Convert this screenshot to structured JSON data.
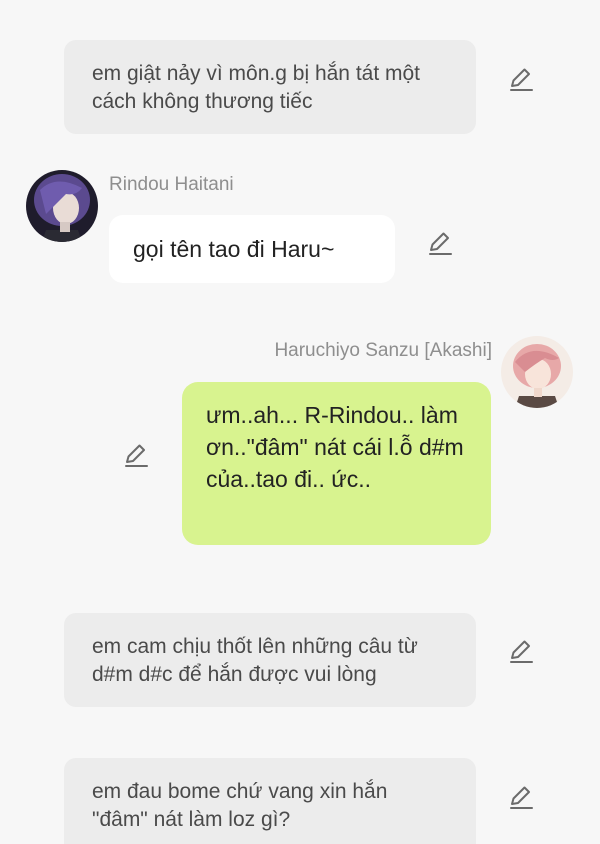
{
  "messages": [
    {
      "type": "narration",
      "text": "em giật nảy vì môn.g bị hắn tát một cách không thương tiếc"
    },
    {
      "type": "chat",
      "side": "left",
      "sender": "Rindou Haitani",
      "text": "gọi tên tao đi Haru~"
    },
    {
      "type": "chat",
      "side": "right",
      "sender": "Haruchiyo Sanzu [Akashi]",
      "text": "ưm..ah... R-Rindou.. làm ơn..\"đâm\" nát cái l.ỗ d#m của..tao đi.. ức.."
    },
    {
      "type": "narration",
      "text": "em cam chịu thốt lên những câu từ d#m d#c để hắn được vui lòng"
    },
    {
      "type": "narration",
      "text": "em đau bome chứ vang xin hắn \"đâm\" nát làm loz gì?"
    }
  ],
  "icons": {
    "edit": "pencil-icon"
  },
  "colors": {
    "background": "#f7f7f7",
    "narration_bg": "#ececec",
    "left_bubble_bg": "#ffffff",
    "right_bubble_bg": "#d8f38f",
    "sender_text": "#8e8e8e"
  }
}
